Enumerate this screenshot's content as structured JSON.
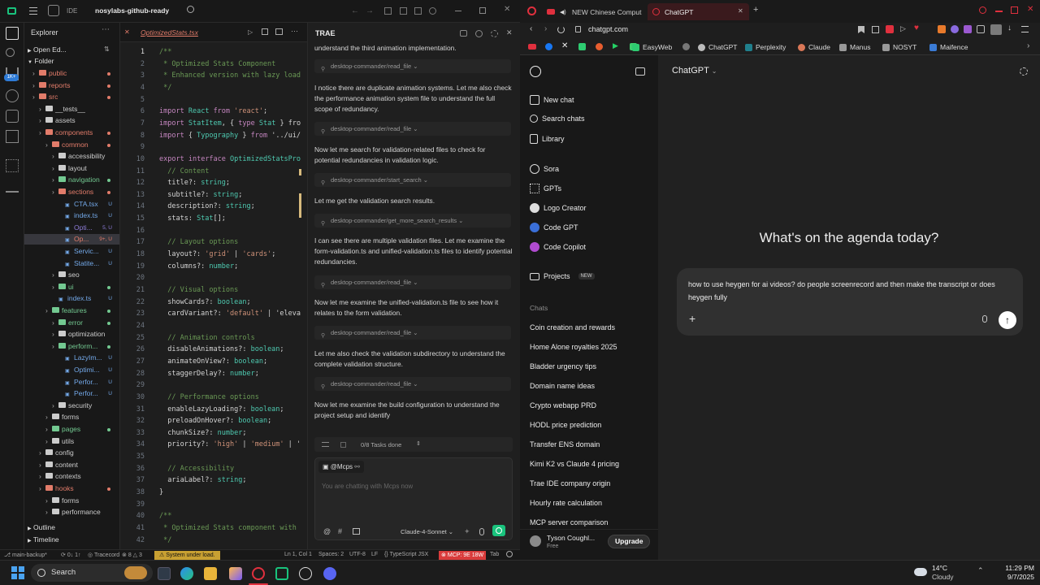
{
  "ide": {
    "app_badge": "IDE",
    "project": "nosylabs-github-ready",
    "explorer": {
      "title": "Explorer",
      "open_editors": "Open Ed...",
      "folder": "Folder",
      "items": [
        {
          "label": "public",
          "type": "folder",
          "depth": 1,
          "color": "#e27c6a"
        },
        {
          "label": "reports",
          "type": "folder",
          "depth": 1,
          "color": "#e27c6a"
        },
        {
          "label": "src",
          "type": "folder",
          "depth": 1,
          "color": "#e27c6a"
        },
        {
          "label": "__tests__",
          "type": "folder",
          "depth": 2,
          "color": "#cccccc"
        },
        {
          "label": "assets",
          "type": "folder",
          "depth": 2,
          "color": "#cccccc"
        },
        {
          "label": "components",
          "type": "folder",
          "depth": 2,
          "color": "#e27c6a"
        },
        {
          "label": "common",
          "type": "folder",
          "depth": 3,
          "color": "#e27c6a"
        },
        {
          "label": "accessibility",
          "type": "folder",
          "depth": 4,
          "color": "#cccccc"
        },
        {
          "label": "layout",
          "type": "folder",
          "depth": 4,
          "color": "#cccccc"
        },
        {
          "label": "navigation",
          "type": "folder",
          "depth": 4,
          "color": "#73c991"
        },
        {
          "label": "sections",
          "type": "folder",
          "depth": 4,
          "color": "#e27c6a"
        },
        {
          "label": "CTA.tsx",
          "type": "file",
          "depth": 5,
          "color": "#73a8e8",
          "badge": "U"
        },
        {
          "label": "index.ts",
          "type": "file",
          "depth": 5,
          "color": "#73a8e8",
          "badge": "U"
        },
        {
          "label": "Opti...",
          "type": "file",
          "depth": 5,
          "color": "#8d7cd8",
          "badge": "5, U"
        },
        {
          "label": "Op...",
          "type": "file",
          "depth": 5,
          "color": "#e27c6a",
          "badge": "9+, U",
          "selected": true
        },
        {
          "label": "Servic...",
          "type": "file",
          "depth": 5,
          "color": "#73a8e8",
          "badge": "U"
        },
        {
          "label": "Statite...",
          "type": "file",
          "depth": 5,
          "color": "#73a8e8",
          "badge": "U"
        },
        {
          "label": "seo",
          "type": "folder",
          "depth": 4,
          "color": "#cccccc"
        },
        {
          "label": "ui",
          "type": "folder",
          "depth": 4,
          "color": "#73c991"
        },
        {
          "label": "index.ts",
          "type": "file",
          "depth": 4,
          "color": "#73a8e8",
          "badge": "U"
        },
        {
          "label": "features",
          "type": "folder",
          "depth": 3,
          "color": "#73c991"
        },
        {
          "label": "error",
          "type": "folder",
          "depth": 4,
          "color": "#73c991"
        },
        {
          "label": "optimization",
          "type": "folder",
          "depth": 4,
          "color": "#cccccc"
        },
        {
          "label": "perform...",
          "type": "folder",
          "depth": 4,
          "color": "#73c991"
        },
        {
          "label": "LazyIm...",
          "type": "file",
          "depth": 5,
          "color": "#73a8e8",
          "badge": "U"
        },
        {
          "label": "Optimi...",
          "type": "file",
          "depth": 5,
          "color": "#73a8e8",
          "badge": "U"
        },
        {
          "label": "Perfor...",
          "type": "file",
          "depth": 5,
          "color": "#73a8e8",
          "badge": "U"
        },
        {
          "label": "Perfor...",
          "type": "file",
          "depth": 5,
          "color": "#73a8e8",
          "badge": "U"
        },
        {
          "label": "security",
          "type": "folder",
          "depth": 4,
          "color": "#cccccc"
        },
        {
          "label": "forms",
          "type": "folder",
          "depth": 3,
          "color": "#cccccc"
        },
        {
          "label": "pages",
          "type": "folder",
          "depth": 3,
          "color": "#73c991"
        },
        {
          "label": "utils",
          "type": "folder",
          "depth": 3,
          "color": "#cccccc"
        },
        {
          "label": "config",
          "type": "folder",
          "depth": 2,
          "color": "#cccccc"
        },
        {
          "label": "content",
          "type": "folder",
          "depth": 2,
          "color": "#cccccc"
        },
        {
          "label": "contexts",
          "type": "folder",
          "depth": 2,
          "color": "#cccccc"
        },
        {
          "label": "hooks",
          "type": "folder",
          "depth": 2,
          "color": "#e27c6a"
        },
        {
          "label": "forms",
          "type": "folder",
          "depth": 3,
          "color": "#cccccc"
        },
        {
          "label": "performance",
          "type": "folder",
          "depth": 3,
          "color": "#cccccc"
        }
      ],
      "outline": "Outline",
      "timeline": "Timeline"
    },
    "editor": {
      "tab": "OptimizedStats.tsx",
      "lines": [
        "/**",
        " * Optimized Stats Component",
        " * Enhanced version with lazy load",
        " */",
        "",
        "import React from 'react';",
        "import StatItem, { type Stat } fro",
        "import { Typography } from '../ui/",
        "",
        "export interface OptimizedStatsPro",
        "  // Content",
        "  title?: string;",
        "  subtitle?: string;",
        "  description?: string;",
        "  stats: Stat[];",
        "",
        "  // Layout options",
        "  layout?: 'grid' | 'cards';",
        "  columns?: number;",
        "",
        "  // Visual options",
        "  showCards?: boolean;",
        "  cardVariant?: 'default' | 'eleva",
        "",
        "  // Animation controls",
        "  disableAnimations?: boolean;",
        "  animateOnView?: boolean;",
        "  staggerDelay?: number;",
        "",
        "  // Performance options",
        "  enableLazyLoading?: boolean;",
        "  preloadOnHover?: boolean;",
        "  chunkSize?: number;",
        "  priority?: 'high' | 'medium' | '",
        "",
        "  // Accessibility",
        "  ariaLabel?: string;",
        "}",
        "",
        "/**",
        " * Optimized Stats component with",
        " */"
      ]
    },
    "trae": {
      "title": "TRAE",
      "messages": [
        "understand the third animation implementation.",
        "I notice there are duplicate animation systems. Let me also check the performance animation system file to understand the full scope of redundancy.",
        "Now let me search for validation-related files to check for potential redundancies in validation logic.",
        "Let me get the validation search results.",
        "I can see there are multiple validation files. Let me examine the form-validation.ts and unified-validation.ts files to identify potential redundancies.",
        "Now let me examine the unified-validation.ts file to see how it relates to the form validation.",
        "Let me also check the validation subdirectory to understand the complete validation structure.",
        "Now let me examine the build configuration to understand the project setup and identify"
      ],
      "tools": [
        "desktop-commander/read_file",
        "desktop-commander/read_file",
        "desktop-commander/start_search",
        "desktop-commander/get_more_search_results",
        "desktop-commander/read_file",
        "desktop-commander/read_file",
        "desktop-commander/read_file"
      ],
      "tasks_done": "0/8 Tasks done",
      "agent": "@Mcps",
      "input_placeholder": "You are chatting with Mcps now",
      "model": "Claude-4-Sonnet"
    },
    "status": {
      "branch": "main-backup*",
      "sync": "0↓ 1↑",
      "tracecord": "Tracecord",
      "problems": "8",
      "warnings": "3",
      "system": "System under load.",
      "position": "Ln 1, Col 1",
      "spaces": "Spaces: 2",
      "encoding": "UTF-8",
      "eol": "LF",
      "language": "TypeScript JSX",
      "mcp": "MCP: 9E 18W",
      "tab": "Tab"
    }
  },
  "browser": {
    "tabs": [
      {
        "label": "NEW Chinese Comput",
        "active": false
      },
      {
        "label": "ChatGPT",
        "active": true
      }
    ],
    "url": "chatgpt.com",
    "bookmarks": [
      "EasyWeb",
      "ChatGPT",
      "Perplexity",
      "Claude",
      "Manus",
      "NOSYT",
      "Maifence"
    ],
    "sidebar": {
      "top": [
        "New chat",
        "Search chats",
        "Library"
      ],
      "apps": [
        "Sora",
        "GPTs",
        "Logo Creator",
        "Code GPT",
        "Code Copilot"
      ],
      "projects": "Projects",
      "projects_badge": "NEW",
      "chats_heading": "Chats",
      "chats": [
        "Coin creation and rewards",
        "Home Alone royalties 2025",
        "Bladder urgency tips",
        "Domain name ideas",
        "Crypto webapp PRD",
        "HODL price prediction",
        "Transfer ENS domain",
        "Kimi K2 vs Claude 4 pricing",
        "Trae IDE company origin",
        "Hourly rate calculation",
        "MCP server comparison"
      ],
      "user_name": "Tyson Coughl...",
      "user_plan": "Free",
      "upgrade": "Upgrade"
    },
    "main": {
      "model": "ChatGPT",
      "heading": "What's on the agenda today?",
      "prompt": "how to use heygen for ai videos? do people screenrecord and then make the transcript or does heygen fully"
    }
  },
  "taskbar": {
    "search": "Search",
    "weather_temp": "14°C",
    "weather_desc": "Cloudy",
    "time": "11:29 PM",
    "date": "9/7/2025"
  },
  "colors": {
    "accent_green": "#19c37d",
    "status_red": "#d93b3b",
    "folder_red": "#e27c6a",
    "folder_green": "#73c991"
  }
}
